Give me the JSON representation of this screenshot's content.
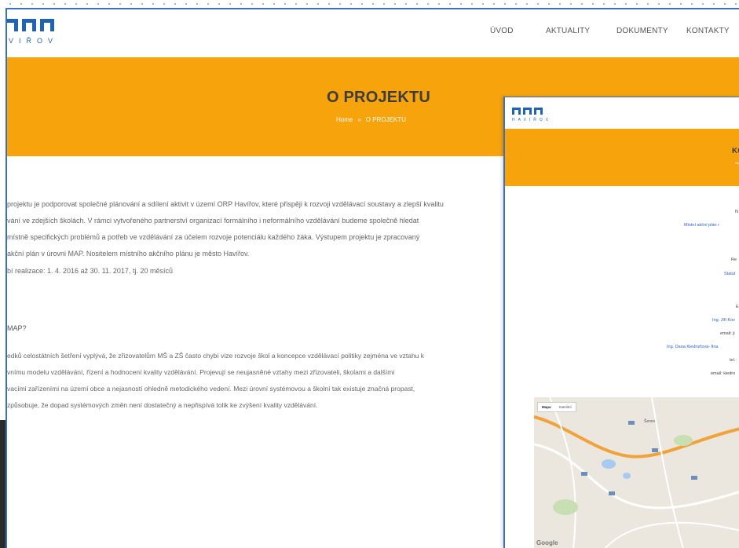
{
  "header": {
    "logo_text": "VIŘOV",
    "nav": [
      "ÚVOD",
      "AKTUALITY",
      "DOKUMENTY",
      "KONTAKTY"
    ]
  },
  "banner": {
    "title": "O PROJEKTU",
    "breadcrumb_home": "Home",
    "breadcrumb_sep": "»",
    "breadcrumb_current": "O PROJEKTU"
  },
  "article": {
    "paragraph1": [
      "projektu je podporovat společné plánování a sdílení aktivit v území ORP Havířov, které přispěji k rozvoji vzdělávací soustavy a zlepší kvalitu",
      "vání ve zdejších školách. V rámci vytvořeného partnerství organizací formálního i neformálního vzdělávání budeme společně hledat",
      "místně specifických problémů a potřeb ve vzdělávání za účelem rozvoje potenciálu každého žáka. Výstupem projektu je zpracovaný",
      "akční plán v úrovni MAP. Nositelem místního akčního plánu je město Havířov."
    ],
    "dates": "bí realizace: 1. 4. 2016 až 30. 11. 2017, tj. 20 měsíců",
    "heading_map": "MAP?",
    "paragraph2": [
      "edků celostátních šetření vyplývá, že zřizovatelům MŠ a ZŠ často chybí vize rozvoje škol a koncepce vzdělávací politiky zejména ve vztahu k",
      "vnímu modelu vzdělávání, řízení a hodnocení kvality vzdělávání. Projevují se neujasněné vztahy mezi zřizovateli, školami a dalšími",
      "vacími zařízeními na území obce a nejasností ohledně metodického vedení. Mezi úrovní systémovou a školní tak existuje značná propast,",
      "způsobuje, že dopad systémových změn není dostatečný a nepřispívá tolik ke zvýšení kvality vzdělávání."
    ]
  },
  "overlay": {
    "logo_text": "HAVÍŘOV",
    "title": "KC",
    "crumb": "Ho",
    "lines": [
      {
        "text": "N",
        "style": "dark"
      },
      {
        "text": "Místní akční plán r",
        "style": "link"
      },
      {
        "text": "Re",
        "style": "dark"
      },
      {
        "text": "Statut",
        "style": "link"
      },
      {
        "text": "E",
        "style": "dark"
      },
      {
        "text": "Ing. Jiří Kov",
        "style": "link"
      },
      {
        "text": "email: ji",
        "style": "dark"
      },
      {
        "text": "Ing. Dana Kiedroňová- fina",
        "style": "link"
      },
      {
        "text": "tel.:",
        "style": "dark"
      },
      {
        "text": "email: kiedro",
        "style": "dark"
      }
    ],
    "map": {
      "tab_active": "Mapa",
      "tab_other": "Satelitní",
      "brand": "Google",
      "label_town": "Šenov"
    }
  },
  "colors": {
    "accent": "#f7a30c",
    "brand_blue": "#1f63b6",
    "link": "#2a5fd0"
  }
}
